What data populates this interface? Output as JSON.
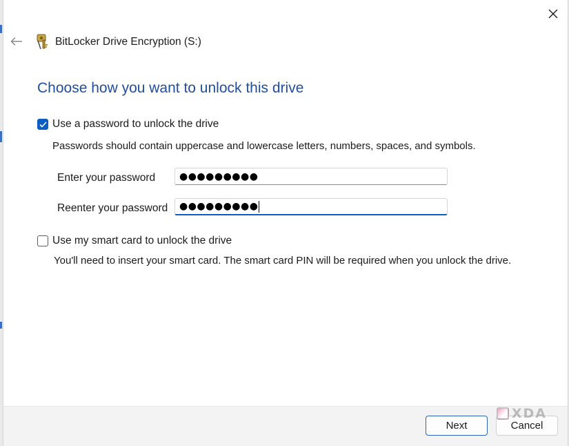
{
  "window": {
    "title": "BitLocker Drive Encryption (S:)"
  },
  "heading": "Choose how you want to unlock this drive",
  "password_option": {
    "label": "Use a password to unlock the drive",
    "checked": true,
    "hint": "Passwords should contain uppercase and lowercase letters, numbers, spaces, and symbols.",
    "enter_label": "Enter your password",
    "enter_value": "●●●●●●●●●",
    "reenter_label": "Reenter your password",
    "reenter_value": "●●●●●●●●●"
  },
  "smartcard_option": {
    "label": "Use my smart card to unlock the drive",
    "checked": false,
    "hint": "You'll need to insert your smart card. The smart card PIN will be required when you unlock the drive."
  },
  "footer": {
    "next_label": "Next",
    "cancel_label": "Cancel"
  },
  "watermark": {
    "text": "XDA"
  },
  "colors": {
    "heading": "#1f4e9e",
    "accent": "#0a5dc2",
    "footer_bg": "#f3f3f3"
  },
  "icons": {
    "close": "close-icon",
    "back": "back-arrow-icon",
    "title": "bitlocker-key-icon",
    "check": "checkmark-icon"
  }
}
